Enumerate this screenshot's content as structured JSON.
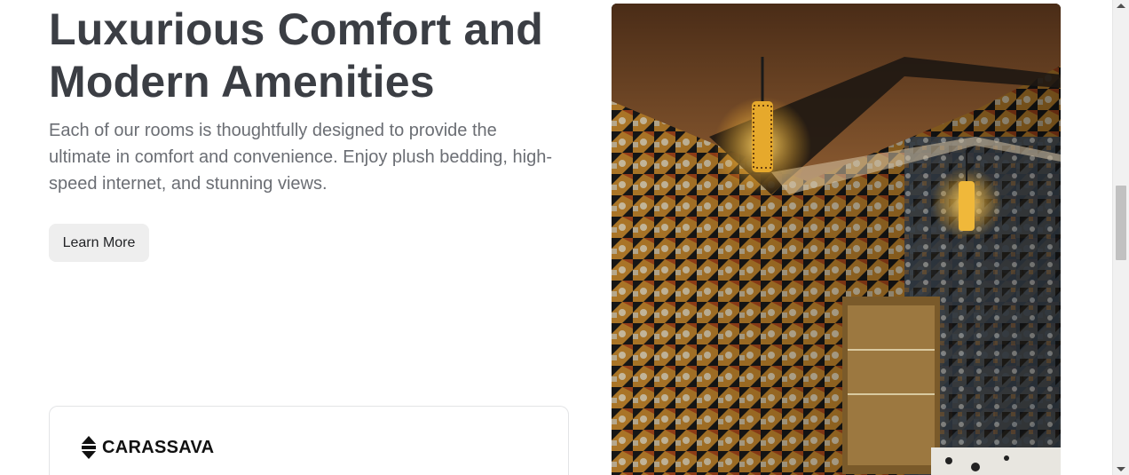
{
  "hero": {
    "headline_line1": "Luxurious Comfort and",
    "headline_line2": "Modern Amenities",
    "description": "Each of our rooms is thoughtfully designed to provide the ultimate in comfort and convenience. Enjoy plush bedding, high-speed internet, and stunning views.",
    "cta_label": "Learn More"
  },
  "card": {
    "brand_name": "CARASSAVA",
    "brand_icon": "carassava-logo"
  },
  "photo": {
    "subject": "room-interior-with-patterned-tiles-and-pendant-lamps"
  },
  "colors": {
    "headline": "#3b3e44",
    "body_text": "#6b6e74",
    "button_bg": "#eeeeee",
    "card_border": "#e3e4e6"
  },
  "scrollbar": {
    "position": 0.39
  }
}
